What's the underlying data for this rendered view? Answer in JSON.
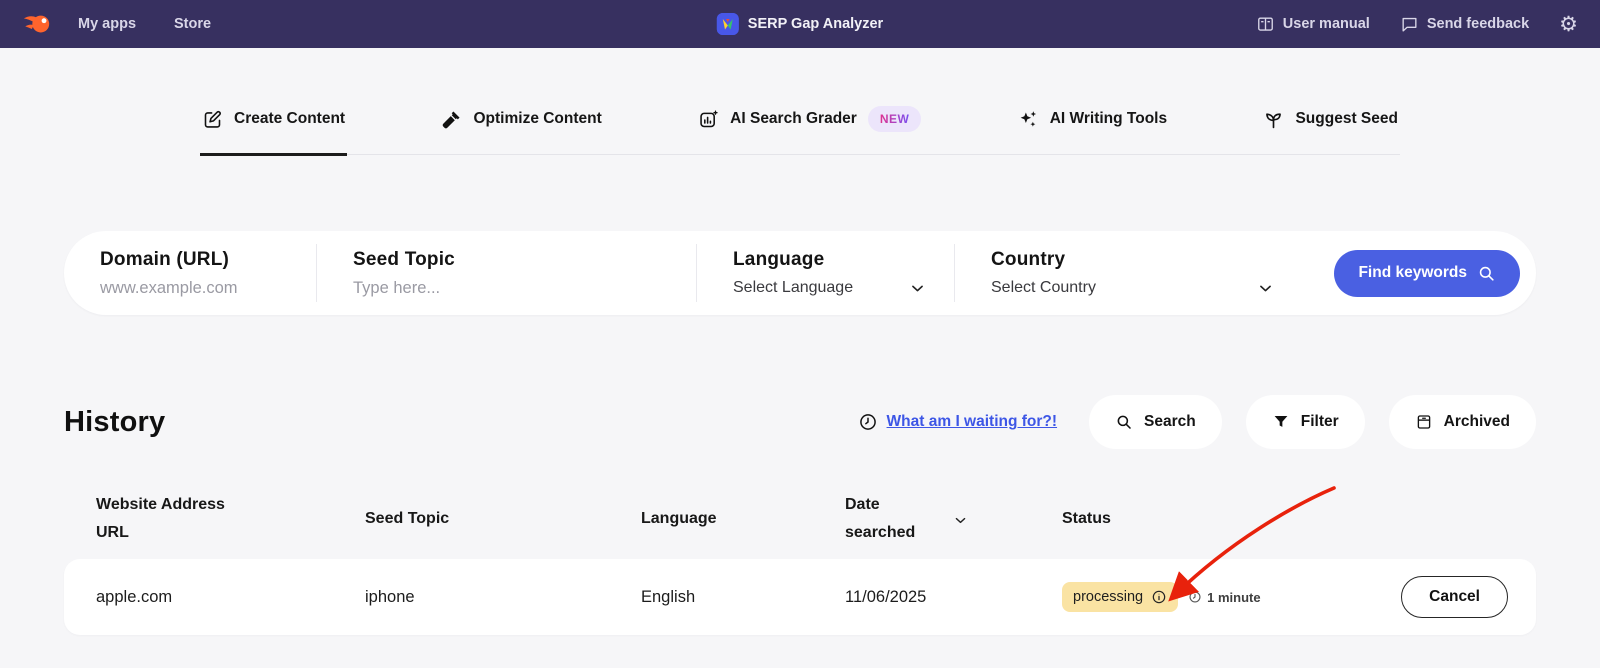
{
  "topbar": {
    "nav": [
      {
        "label": "My apps"
      },
      {
        "label": "Store"
      }
    ],
    "app_title": "SERP Gap Analyzer",
    "actions": [
      {
        "label": "User manual"
      },
      {
        "label": "Send feedback"
      }
    ],
    "gear_glyph": "⚙"
  },
  "tabs": [
    {
      "label": "Create Content",
      "active": true
    },
    {
      "label": "Optimize Content"
    },
    {
      "label": "AI Search Grader",
      "badge": "NEW"
    },
    {
      "label": "AI Writing Tools"
    },
    {
      "label": "Suggest Seed"
    }
  ],
  "search_form": {
    "fields": [
      {
        "label": "Domain (URL)",
        "placeholder": "www.example.com"
      },
      {
        "label": "Seed Topic",
        "placeholder": "Type here..."
      },
      {
        "label": "Language",
        "value": "Select Language"
      },
      {
        "label": "Country",
        "value": "Select Country"
      }
    ],
    "submit_label": "Find keywords"
  },
  "history": {
    "title": "History",
    "waiting_link": "What am I waiting for?!",
    "buttons": [
      {
        "label": "Search"
      },
      {
        "label": "Filter"
      },
      {
        "label": "Archived"
      }
    ]
  },
  "table": {
    "headers": {
      "website": "Website Address URL",
      "seed": "Seed Topic",
      "language": "Language",
      "date": "Date searched",
      "status": "Status"
    },
    "rows": [
      {
        "website": "apple.com",
        "seed": "iphone",
        "language": "English",
        "date": "11/06/2025",
        "status": "processing",
        "time": "1 minute",
        "action": "Cancel"
      }
    ]
  },
  "colors": {
    "topbar_bg": "#373060",
    "page_bg": "#f6f6f8",
    "brand_orange": "#ff642d",
    "primary_blue": "#4a60e2",
    "link_blue": "#3d56e6",
    "status_badge_bg": "#fae3a3",
    "new_badge_bg": "#ece5fb",
    "arrow_red": "#e8220c"
  }
}
